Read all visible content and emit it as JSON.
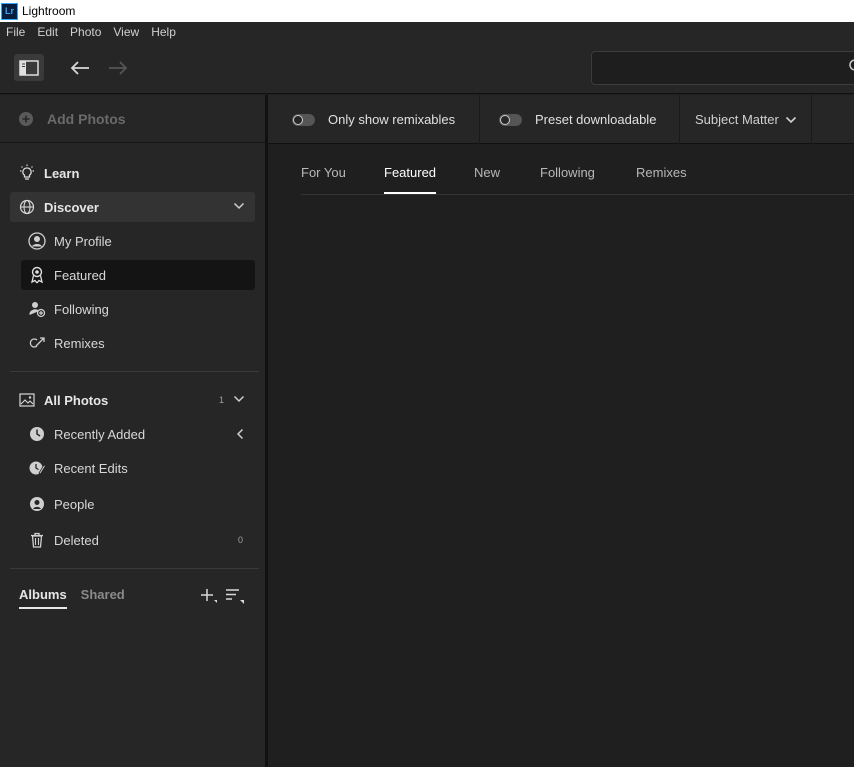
{
  "window": {
    "app_logo": "Lr",
    "title": "Lightroom"
  },
  "menu": [
    "File",
    "Edit",
    "Photo",
    "View",
    "Help"
  ],
  "toolbar": {
    "search_value": ""
  },
  "sidebar": {
    "add_photos": "Add Photos",
    "learn": "Learn",
    "discover": "Discover",
    "discover_items": [
      "My Profile",
      "Featured",
      "Following",
      "Remixes"
    ],
    "all_photos": "All Photos",
    "all_photos_count": "1",
    "photo_items": [
      "Recently Added",
      "Recent Edits",
      "People",
      "Deleted"
    ],
    "deleted_count": "0",
    "album_tabs": [
      "Albums",
      "Shared"
    ]
  },
  "filters": {
    "remixables": "Only show remixables",
    "preset": "Preset downloadable",
    "subject": "Subject Matter"
  },
  "tabs": [
    "For You",
    "Featured",
    "New",
    "Following",
    "Remixes"
  ],
  "colors": {
    "background": "#1e1e1e",
    "panel": "#262626",
    "selected": "#141414",
    "logo_blue": "#31a8ff"
  }
}
